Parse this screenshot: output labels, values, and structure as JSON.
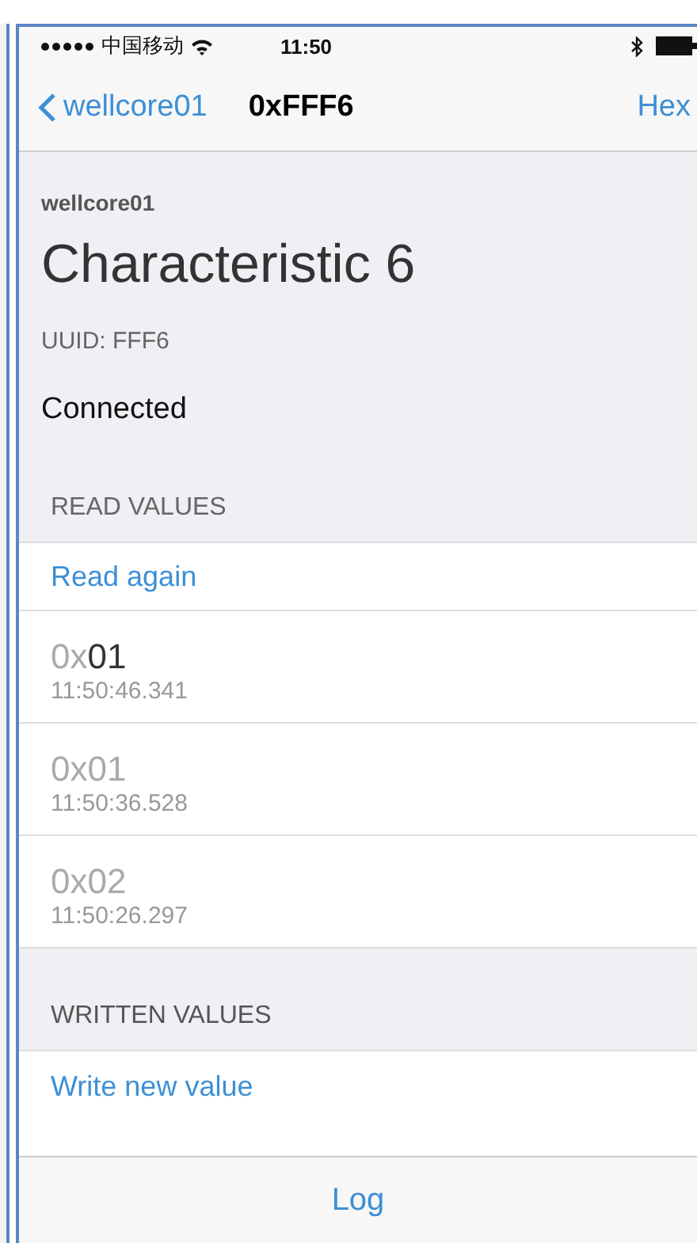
{
  "status_bar": {
    "carrier": "中国移动",
    "time": "11:50"
  },
  "nav_bar": {
    "back": "wellcore01",
    "title": "0xFFF6",
    "action": "Hex"
  },
  "header": {
    "device": "wellcore01",
    "title": "Characteristic 6",
    "uuid": "UUID: FFF6",
    "state": "Connected"
  },
  "read_values": {
    "heading": "READ VALUES",
    "action": "Read again",
    "rows": [
      {
        "prefix": "0x",
        "value": "01",
        "time": "11:50:46.341",
        "latest": true
      },
      {
        "prefix": "0x",
        "value": "01",
        "time": "11:50:36.528",
        "latest": false
      },
      {
        "prefix": "0x",
        "value": "02",
        "time": "11:50:26.297",
        "latest": false
      }
    ]
  },
  "written_values": {
    "heading": "WRITTEN VALUES",
    "action": "Write new value"
  },
  "toolbar": {
    "button": "Log"
  }
}
